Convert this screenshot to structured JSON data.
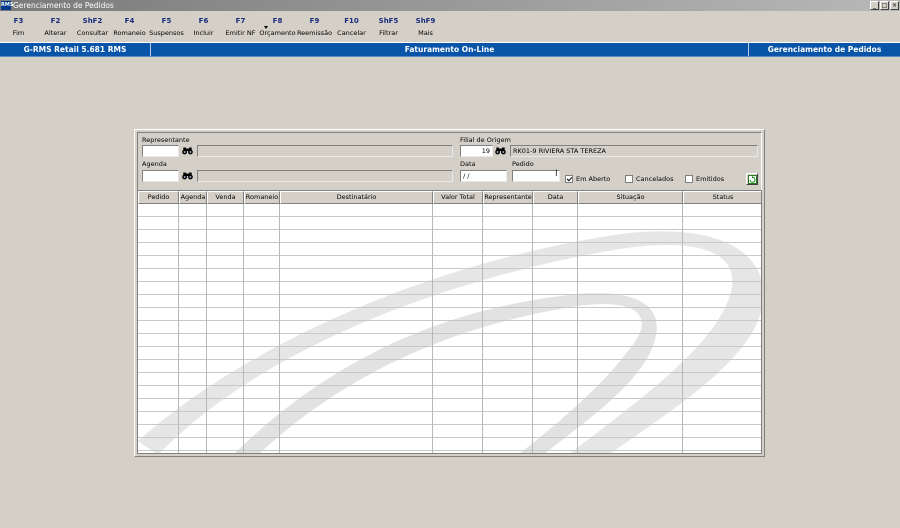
{
  "window": {
    "title": "Gerenciamento de Pedidos",
    "icon_text": "RMS",
    "controls": [
      "_",
      "□",
      "×"
    ]
  },
  "toolbar": {
    "buttons": [
      {
        "key": "F3",
        "label": "Fim"
      },
      {
        "key": "F2",
        "label": "Alterar"
      },
      {
        "key": "ShF2",
        "label": "Consultar"
      },
      {
        "key": "F4",
        "label": "Romaneio"
      },
      {
        "key": "F5",
        "label": "Suspensos"
      },
      {
        "key": "F6",
        "label": "Incluir"
      },
      {
        "key": "F7",
        "label": "Emitir NF"
      },
      {
        "key": "F8",
        "label": "Orçamento"
      },
      {
        "key": "F9",
        "label": "Reemissão"
      },
      {
        "key": "F10",
        "label": "Cancelar"
      },
      {
        "key": "ShF5",
        "label": "Filtrar"
      },
      {
        "key": "ShF9",
        "label": "Mais"
      }
    ]
  },
  "statusbar": {
    "version": "G-RMS Retail 5.681 RMS",
    "module": "Faturamento On-Line",
    "screen": "Gerenciamento de Pedidos"
  },
  "form": {
    "representante_label": "Representante",
    "representante_code": "",
    "representante_name": "",
    "filial_label": "Filial de Origem",
    "filial_code": "19",
    "filial_name": "RK01-9 RIVIERA STA TEREZA",
    "agenda_label": "Agenda",
    "agenda_code": "",
    "agenda_name": "",
    "data_label": "Data",
    "data_value": " / /",
    "pedido_label": "Pedido",
    "pedido_value": "",
    "chk_em_aberto": {
      "label": "Em Aberto",
      "checked": true
    },
    "chk_cancelados": {
      "label": "Cancelados",
      "checked": false
    },
    "chk_emitidos": {
      "label": "Emitidos",
      "checked": false
    }
  },
  "grid": {
    "columns": [
      "Pedido",
      "Agenda",
      "Venda",
      "Romaneio",
      "Destinatário",
      "Valor Total",
      "Representante",
      "Data",
      "Situação",
      "Status"
    ],
    "rows": []
  }
}
